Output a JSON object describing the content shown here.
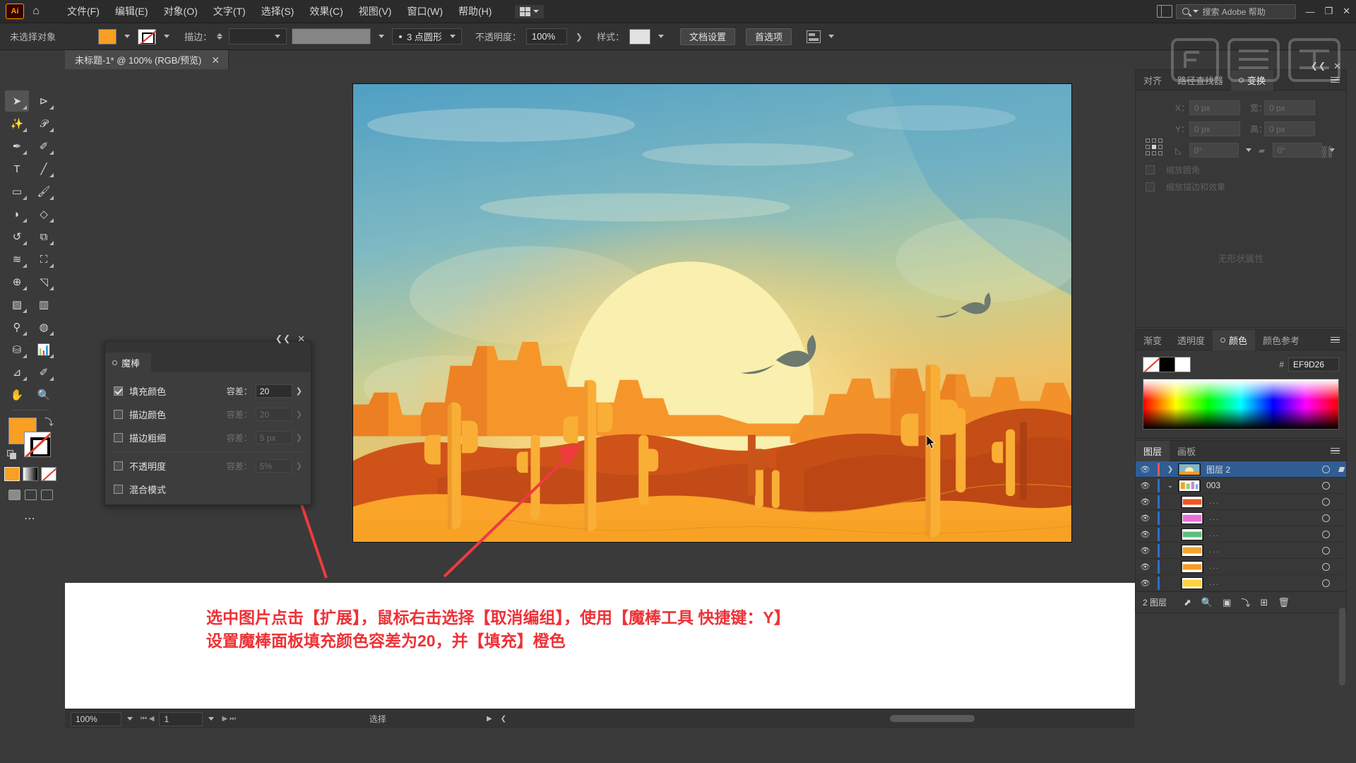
{
  "app": {
    "logo": "Ai",
    "home_icon": "home-icon"
  },
  "menubar": {
    "items": [
      {
        "label": "文件(F)"
      },
      {
        "label": "编辑(E)"
      },
      {
        "label": "对象(O)"
      },
      {
        "label": "文字(T)"
      },
      {
        "label": "选择(S)"
      },
      {
        "label": "效果(C)"
      },
      {
        "label": "视图(V)"
      },
      {
        "label": "窗口(W)"
      },
      {
        "label": "帮助(H)"
      }
    ],
    "search_placeholder": "搜索 Adobe 帮助",
    "window_buttons": {
      "minimize": "—",
      "restore": "❐",
      "close": "✕"
    }
  },
  "controlbar": {
    "selection_status": "未选择对象",
    "fill_color": "#F89F24",
    "stroke_label": "描边：",
    "stroke_weight": "",
    "stroke_profile": "3 点圆形",
    "opacity_label": "不透明度：",
    "opacity_value": "100%",
    "style_label": "样式：",
    "doc_setup_btn": "文档设置",
    "preferences_btn": "首选项"
  },
  "tabbar": {
    "doc_title": "未标题-1* @ 100% (RGB/预览)",
    "close": "✕"
  },
  "toolbar": {
    "tools": [
      {
        "name": "selection-tool",
        "glyph": "➤",
        "active": true
      },
      {
        "name": "direct-selection-tool",
        "glyph": "➤",
        "active": false
      },
      {
        "name": "magic-wand-tool",
        "glyph": "✨",
        "active": false
      },
      {
        "name": "lasso-tool",
        "glyph": "ᗡ",
        "active": false
      },
      {
        "name": "pen-tool",
        "glyph": "✒",
        "active": false
      },
      {
        "name": "curvature-tool",
        "glyph": "✎",
        "active": false
      },
      {
        "name": "type-tool",
        "glyph": "T",
        "active": false
      },
      {
        "name": "line-segment-tool",
        "glyph": "╱",
        "active": false
      },
      {
        "name": "rectangle-tool",
        "glyph": "▭",
        "active": false
      },
      {
        "name": "paintbrush-tool",
        "glyph": "🖌",
        "active": false
      },
      {
        "name": "shaper-tool",
        "glyph": "◗",
        "active": false
      },
      {
        "name": "eraser-tool",
        "glyph": "◇",
        "active": false
      },
      {
        "name": "rotate-tool",
        "glyph": "↺",
        "active": false
      },
      {
        "name": "scale-tool",
        "glyph": "⧉",
        "active": false
      },
      {
        "name": "width-tool",
        "glyph": "≋",
        "active": false
      },
      {
        "name": "free-transform-tool",
        "glyph": "⬚",
        "active": false
      },
      {
        "name": "shape-builder-tool",
        "glyph": "◔",
        "active": false
      },
      {
        "name": "perspective-grid-tool",
        "glyph": "▰",
        "active": false
      },
      {
        "name": "mesh-tool",
        "glyph": "▨",
        "active": false
      },
      {
        "name": "gradient-tool",
        "glyph": "▤",
        "active": false
      },
      {
        "name": "eyedropper-tool",
        "glyph": "⚲",
        "active": false
      },
      {
        "name": "blend-tool",
        "glyph": "◍",
        "active": false
      },
      {
        "name": "symbol-sprayer-tool",
        "glyph": "⛁",
        "active": false
      },
      {
        "name": "column-graph-tool",
        "glyph": "▥",
        "active": false
      },
      {
        "name": "artboard-tool",
        "glyph": "⊿",
        "active": false
      },
      {
        "name": "slice-tool",
        "glyph": "✂",
        "active": false
      },
      {
        "name": "hand-tool",
        "glyph": "✋",
        "active": false
      },
      {
        "name": "zoom-tool",
        "glyph": "🔍",
        "active": false
      }
    ],
    "fill_color": "#F89F24",
    "stroke_color": "none",
    "more_tools": "⋯"
  },
  "magic_wand_panel": {
    "title": "魔棒",
    "rows": [
      {
        "label": "填充颜色",
        "checked": true,
        "tol_label": "容差：",
        "tol_value": "20",
        "enabled": true
      },
      {
        "label": "描边颜色",
        "checked": false,
        "tol_label": "容差：",
        "tol_value": "20",
        "enabled": false
      },
      {
        "label": "描边粗细",
        "checked": false,
        "tol_label": "容差：",
        "tol_value": "5 px",
        "enabled": false
      },
      {
        "label": "不透明度",
        "checked": false,
        "tol_label": "容差：",
        "tol_value": "5%",
        "enabled": false
      },
      {
        "label": "混合模式",
        "checked": false,
        "tol_label": "",
        "tol_value": "",
        "enabled": false
      }
    ],
    "close": "✕",
    "collapse": "❮❮"
  },
  "right_panels": {
    "transform_group": {
      "tabs": [
        {
          "label": "对齐",
          "active": false
        },
        {
          "label": "路径查找器",
          "active": false
        },
        {
          "label": "变换",
          "active": true
        }
      ],
      "x_label": "X：",
      "x_value": "0 px",
      "y_label": "Y：",
      "y_value": "0 px",
      "w_label": "宽：",
      "w_value": "0 px",
      "h_label": "高：",
      "h_value": "0 px",
      "angle_value": "0°",
      "shear_value": "0°",
      "scale_corners_label": "缩放圆角",
      "scale_effects_label": "缩放描边和效果",
      "no_attributes": "无形状属性"
    },
    "color_group": {
      "tabs": [
        {
          "label": "渐变",
          "active": false
        },
        {
          "label": "透明度",
          "active": false
        },
        {
          "label": "颜色",
          "active": true
        },
        {
          "label": "颜色参考",
          "active": false
        }
      ],
      "hash": "#",
      "hex_value": "EF9D26"
    },
    "layers_group": {
      "tabs": [
        {
          "label": "图层",
          "active": true
        },
        {
          "label": "画板",
          "active": false
        }
      ],
      "rows": [
        {
          "name": "图层 2",
          "selected": true,
          "bar_color": "#e8584a",
          "indent": 0,
          "thumb": "artwork",
          "twisty": "❯"
        },
        {
          "name": "003",
          "selected": false,
          "bar_color": "#2b6fd4",
          "indent": 0,
          "thumb": "group",
          "twisty": "⌄"
        },
        {
          "name": "...",
          "selected": false,
          "bar_color": "#2b6fd4",
          "indent": 1,
          "thumb": "red",
          "twisty": ""
        },
        {
          "name": "...",
          "selected": false,
          "bar_color": "#2b6fd4",
          "indent": 1,
          "thumb": "magenta",
          "twisty": ""
        },
        {
          "name": "...",
          "selected": false,
          "bar_color": "#2b6fd4",
          "indent": 1,
          "thumb": "green",
          "twisty": ""
        },
        {
          "name": "...",
          "selected": false,
          "bar_color": "#2b6fd4",
          "indent": 1,
          "thumb": "orange",
          "twisty": ""
        },
        {
          "name": "...",
          "selected": false,
          "bar_color": "#2b6fd4",
          "indent": 1,
          "thumb": "orange2",
          "twisty": ""
        },
        {
          "name": "...",
          "selected": false,
          "bar_color": "#2b6fd4",
          "indent": 1,
          "thumb": "yellow",
          "twisty": ""
        }
      ],
      "footer_count": "2 图层",
      "footer_icons": [
        "locate-object-icon",
        "search-icon",
        "make-clipping-mask-icon",
        "create-sublayer-icon",
        "create-new-layer-icon",
        "delete-layer-icon"
      ]
    }
  },
  "statusbar": {
    "zoom": "100%",
    "page": "1",
    "status_text": "选择"
  },
  "annotation": {
    "line1": "选中图片点击【扩展】，鼠标右击选择【取消编组】，使用【魔棒工具 快捷键：Y】",
    "line2": "设置魔棒面板填充颜色容差为20，并【填充】橙色"
  },
  "artwork": {
    "description": "desert-sunset-illustration",
    "colors": {
      "sky_top": "#4f9fc4",
      "sky_mid": "#9dc8b8",
      "sky_glow": "#f0c46a",
      "sun": "#f8eeab",
      "mesa_light": "#f9a227",
      "mesa_mid": "#f08522",
      "mesa_dark": "#d4531a",
      "dune_dark": "#c04a18",
      "sand": "#f89f24",
      "cactus": "#f9ae35",
      "bird": "#6e7a70"
    }
  }
}
